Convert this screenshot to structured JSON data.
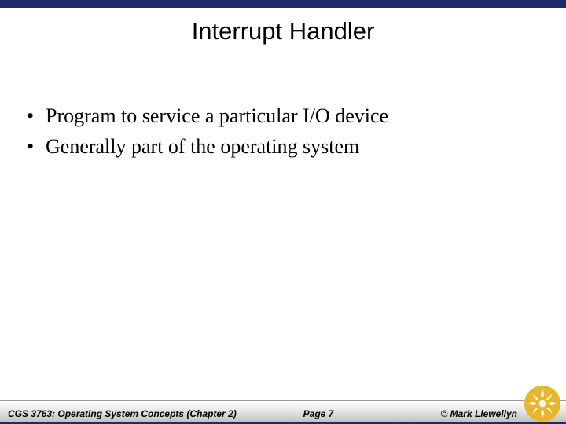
{
  "slide": {
    "title": "Interrupt Handler",
    "bullets": [
      "Program to service a particular I/O device",
      "Generally part of the operating system"
    ]
  },
  "footer": {
    "course": "CGS 3763: Operating System Concepts  (Chapter 2)",
    "page": "Page 7",
    "copyright": "© Mark Llewellyn"
  },
  "logo": {
    "name": "ucf-pegasus-logo",
    "bg": "#e7b62d",
    "fg": "#ffffff"
  }
}
